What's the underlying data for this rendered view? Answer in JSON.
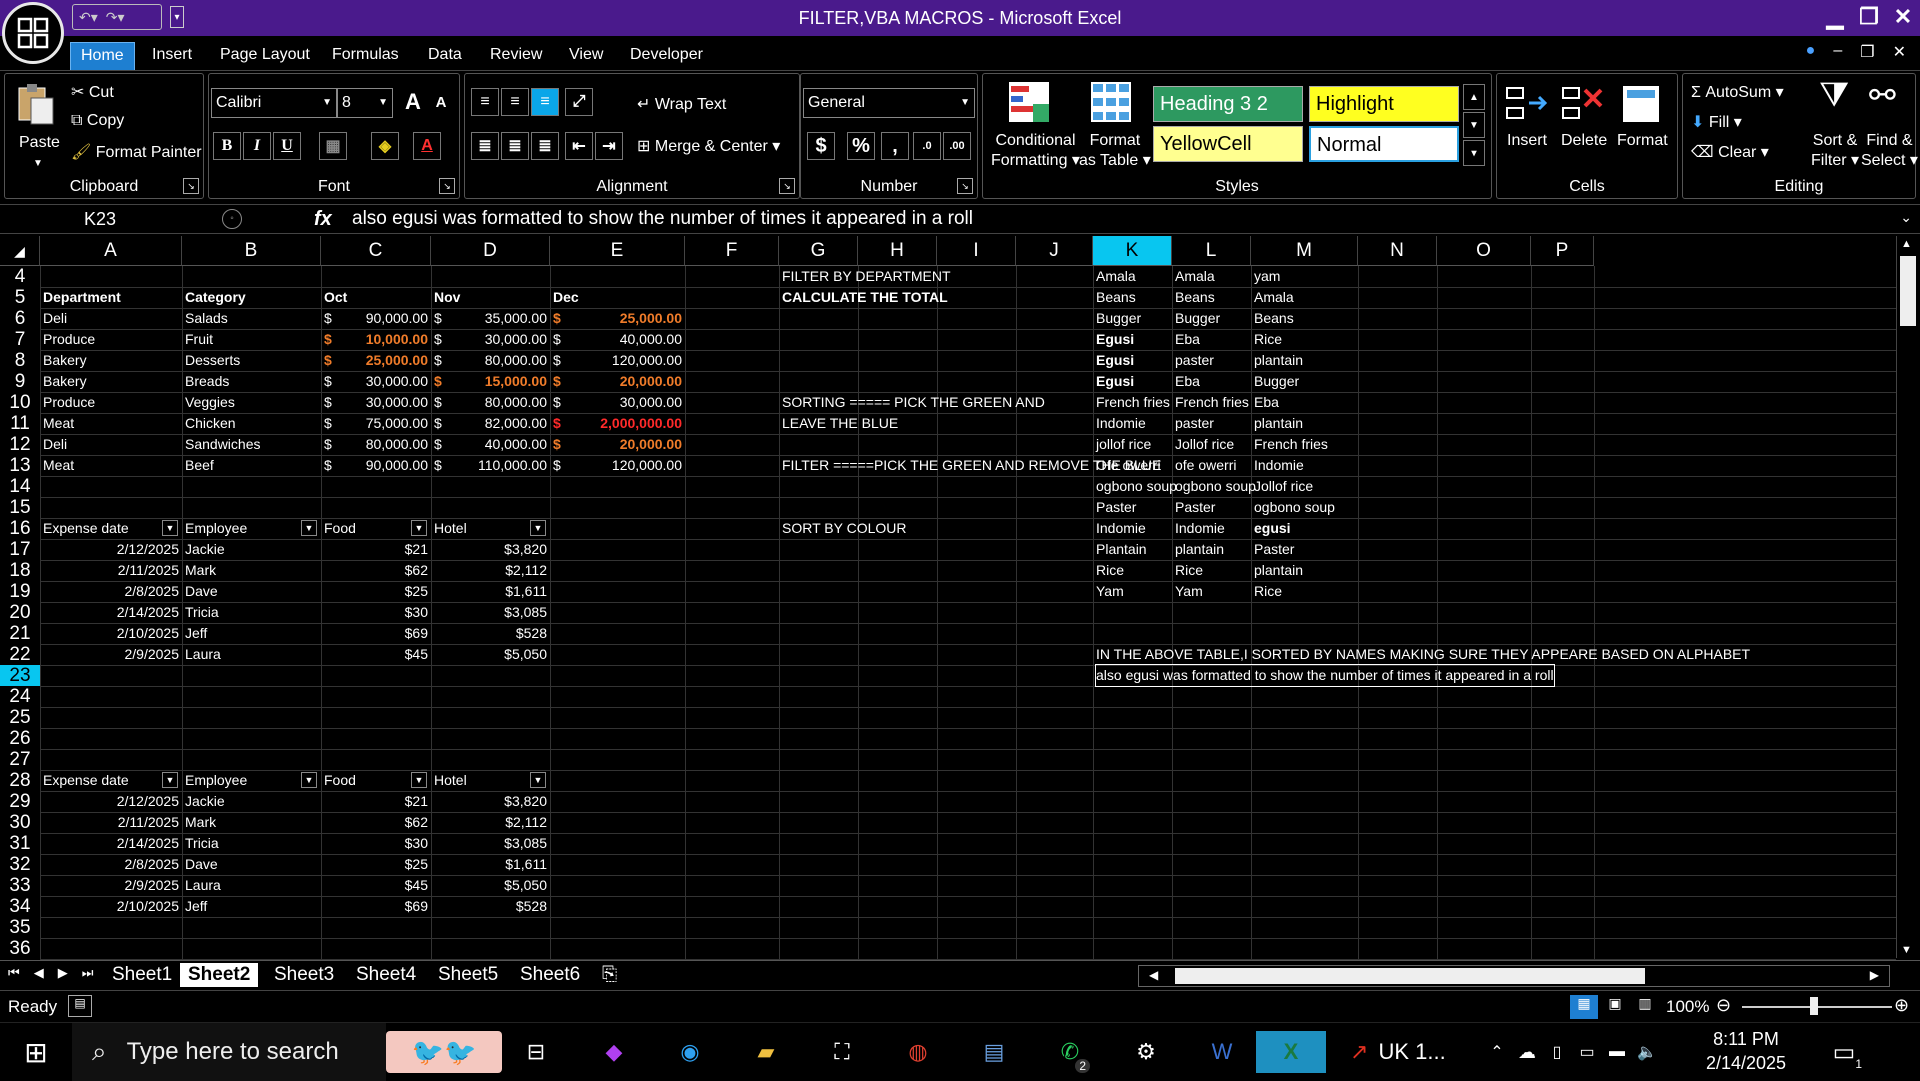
{
  "window": {
    "title": "FILTER,VBA MACROS - Microsoft Excel"
  },
  "tabs": [
    "Home",
    "Insert",
    "Page Layout",
    "Formulas",
    "Data",
    "Review",
    "View",
    "Developer"
  ],
  "ribbon": {
    "clipboard": {
      "label": "Clipboard",
      "paste": "Paste",
      "cut": "Cut",
      "copy": "Copy",
      "format_painter": "Format Painter"
    },
    "font": {
      "label": "Font",
      "name": "Calibri",
      "size": "8",
      "bold": "B",
      "italic": "I",
      "underline": "U"
    },
    "alignment": {
      "label": "Alignment",
      "wrap": "Wrap Text",
      "merge": "Merge & Center"
    },
    "number": {
      "label": "Number",
      "format": "General",
      "currency": "$",
      "percent": "%",
      "comma": ","
    },
    "styles": {
      "label": "Styles",
      "conditional1": "Conditional",
      "conditional2": "Formatting",
      "table1": "Format",
      "table2": "as Table",
      "heading": "Heading 3 2",
      "highlight": "Highlight",
      "yellowcell": "YellowCell",
      "normal": "Normal"
    },
    "cells": {
      "label": "Cells",
      "insert": "Insert",
      "delete": "Delete",
      "format": "Format"
    },
    "editing": {
      "label": "Editing",
      "autosum": "AutoSum",
      "fill": "Fill",
      "clear": "Clear",
      "sort1": "Sort &",
      "sort2": "Filter",
      "find1": "Find &",
      "find2": "Select"
    }
  },
  "formula_bar": {
    "name_box": "K23",
    "fx": "fx",
    "content": "also egusi was formatted to show the number of times it appeared in a roll"
  },
  "columns": [
    "A",
    "B",
    "C",
    "D",
    "E",
    "F",
    "G",
    "H",
    "I",
    "J",
    "K",
    "L",
    "M",
    "N",
    "O",
    "P"
  ],
  "rows": [
    "4",
    "5",
    "6",
    "7",
    "8",
    "9",
    "10",
    "11",
    "12",
    "13",
    "14",
    "15",
    "16",
    "17",
    "18",
    "19",
    "20",
    "21",
    "22",
    "23",
    "24",
    "25",
    "26",
    "27",
    "28",
    "29",
    "30",
    "31",
    "32",
    "33",
    "34",
    "35",
    "36"
  ],
  "table1": {
    "headers": [
      "Department",
      "Category",
      "Oct",
      "Nov",
      "Dec"
    ],
    "rows": [
      [
        "Deli",
        "Salads",
        "90,000.00",
        "35,000.00",
        "25,000.00"
      ],
      [
        "Produce",
        "Fruit",
        "10,000.00",
        "30,000.00",
        "40,000.00"
      ],
      [
        "Bakery",
        "Desserts",
        "25,000.00",
        "80,000.00",
        "120,000.00"
      ],
      [
        "Bakery",
        "Breads",
        "30,000.00",
        "15,000.00",
        "20,000.00"
      ],
      [
        "Produce",
        "Veggies",
        "30,000.00",
        "80,000.00",
        "30,000.00"
      ],
      [
        "Meat",
        "Chicken",
        "75,000.00",
        "82,000.00",
        "2,000,000.00"
      ],
      [
        "Deli",
        "Sandwiches",
        "80,000.00",
        "40,000.00",
        "20,000.00"
      ],
      [
        "Meat",
        "Beef",
        "90,000.00",
        "110,000.00",
        "120,000.00"
      ]
    ],
    "currency": "$"
  },
  "notes": {
    "g4": "FILTER BY DEPARTMENT",
    "g5": "CALCULATE THE TOTAL",
    "g10": "SORTING ===== PICK THE GREEN AND",
    "g11": "LEAVE THE BLUE",
    "g13": "FILTER =====PICK THE GREEN AND REMOVE THE BLUE",
    "g16": "SORT BY COLOUR",
    "k22": "IN THE ABOVE TABLE,I SORTED BY NAMES MAKING SURE THEY APPEARE BASED ON ALPHABET",
    "k23": "also egusi was formatted to show the number of times it appeared in a roll"
  },
  "food_cols": {
    "k": [
      "Amala",
      "Beans",
      "Bugger",
      "Egusi",
      "Egusi",
      "Egusi",
      "French fries",
      "Indomie",
      "jollof  rice",
      "Ofe owerri",
      "ogbono soup",
      "Paster",
      "Indomie",
      "Plantain",
      "Rice",
      "Yam"
    ],
    "l": [
      "Amala",
      "Beans",
      "Bugger",
      "Eba",
      "paster",
      "Eba",
      "French fries",
      "paster",
      "Jollof rice",
      "ofe owerri",
      "ogbono soup",
      "Paster",
      "Indomie",
      "plantain",
      "Rice",
      "Yam"
    ],
    "m": [
      "yam",
      "Amala",
      "Beans",
      "Rice",
      "plantain",
      "Bugger",
      "Eba",
      "plantain",
      "French fries",
      "Indomie",
      "Jollof rice",
      "ogbono soup",
      "egusi",
      "Paster",
      "plantain",
      "Rice"
    ]
  },
  "expense_headers": [
    "Expense date",
    "Employee",
    "Food",
    "Hotel"
  ],
  "expense1": [
    [
      "2/12/2025",
      "Jackie",
      "$21",
      "$3,820"
    ],
    [
      "2/11/2025",
      "Mark",
      "$62",
      "$2,112"
    ],
    [
      "2/8/2025",
      "Dave",
      "$25",
      "$1,611"
    ],
    [
      "2/14/2025",
      "Tricia",
      "$30",
      "$3,085"
    ],
    [
      "2/10/2025",
      "Jeff",
      "$69",
      "$528"
    ],
    [
      "2/9/2025",
      "Laura",
      "$45",
      "$5,050"
    ]
  ],
  "expense2": [
    [
      "2/12/2025",
      "Jackie",
      "$21",
      "$3,820"
    ],
    [
      "2/11/2025",
      "Mark",
      "$62",
      "$2,112"
    ],
    [
      "2/14/2025",
      "Tricia",
      "$30",
      "$3,085"
    ],
    [
      "2/8/2025",
      "Dave",
      "$25",
      "$1,611"
    ],
    [
      "2/9/2025",
      "Laura",
      "$45",
      "$5,050"
    ],
    [
      "2/10/2025",
      "Jeff",
      "$69",
      "$528"
    ]
  ],
  "sheets": [
    "Sheet1",
    "Sheet2",
    "Sheet3",
    "Sheet4",
    "Sheet5",
    "Sheet6"
  ],
  "active_sheet": "Sheet2",
  "status": {
    "ready": "Ready",
    "zoom": "100%"
  },
  "taskbar": {
    "search_placeholder": "Type here to search",
    "whatsapp_badge": "2",
    "uk_label": "UK 1...",
    "time": "8:11 PM",
    "date": "2/14/2025",
    "notif": "1"
  },
  "colors": {
    "titlebar": "#4a1a8c",
    "selected_header": "#08c6f0",
    "accent_tab": "#1e7fd1",
    "orange": "#f07c2a",
    "red": "#ff2a2a"
  }
}
